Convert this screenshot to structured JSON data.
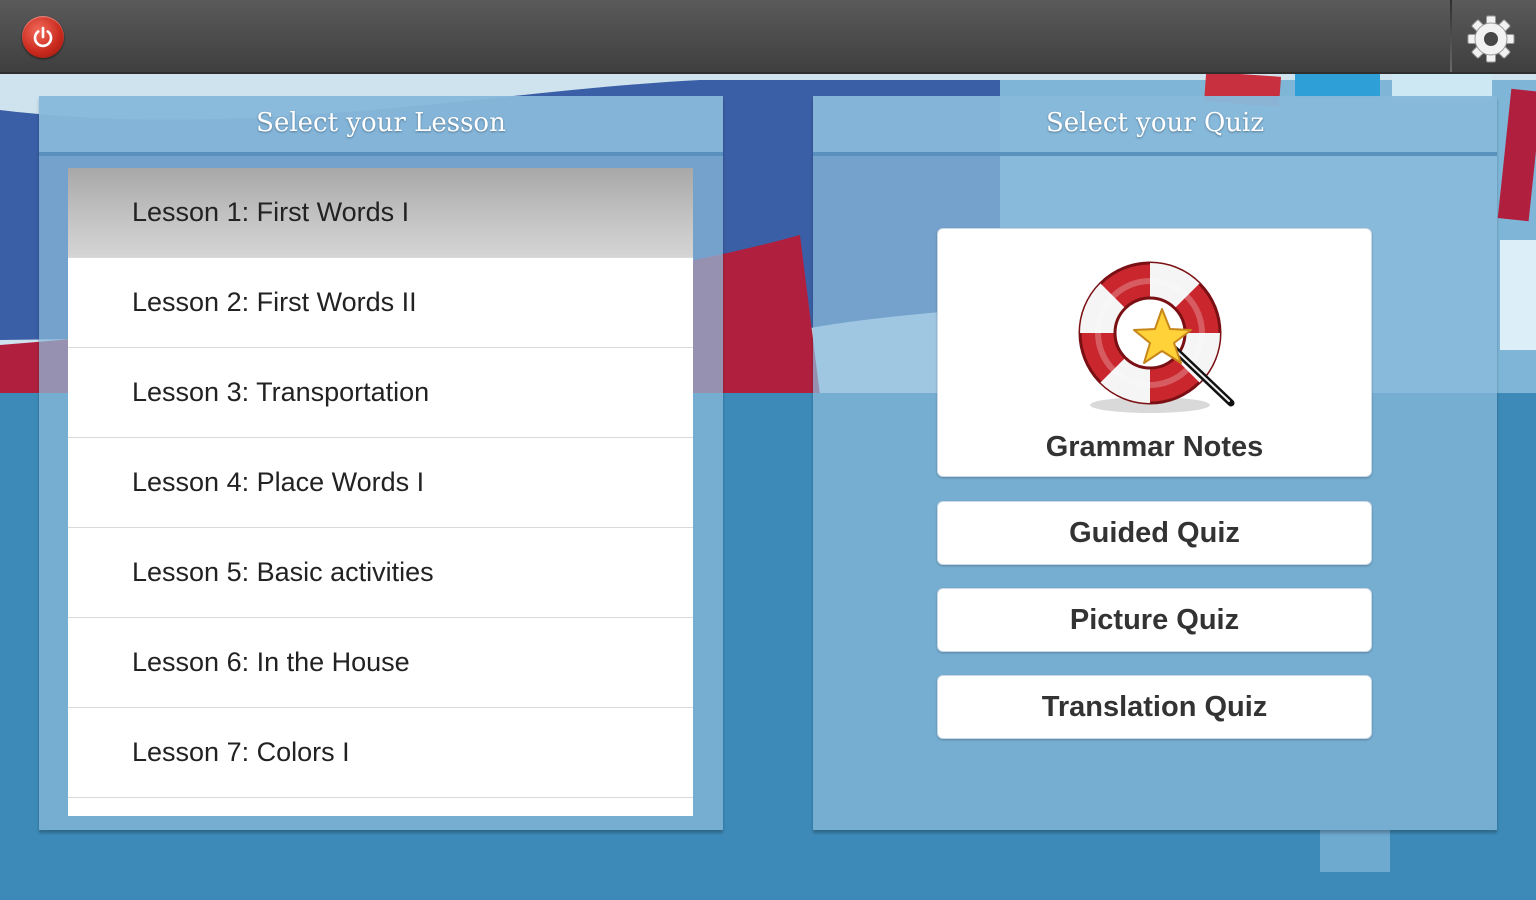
{
  "topbar": {
    "power_icon": "power-icon",
    "settings_icon": "gear-icon"
  },
  "lessons_panel": {
    "title": "Select your Lesson",
    "items": [
      {
        "label": "Lesson 1: First Words I",
        "selected": true
      },
      {
        "label": "Lesson 2: First Words II",
        "selected": false
      },
      {
        "label": "Lesson 3: Transportation",
        "selected": false
      },
      {
        "label": "Lesson 4: Place Words I",
        "selected": false
      },
      {
        "label": "Lesson 5: Basic activities",
        "selected": false
      },
      {
        "label": "Lesson 6: In the House",
        "selected": false
      },
      {
        "label": "Lesson 7: Colors I",
        "selected": false
      }
    ]
  },
  "quiz_panel": {
    "title": "Select your Quiz",
    "grammar_notes": {
      "label": "Grammar Notes",
      "icon": "lifebuoy-magic-wand-icon"
    },
    "guided_quiz": "Guided Quiz",
    "picture_quiz": "Picture Quiz",
    "translation_quiz": "Translation Quiz"
  },
  "colors": {
    "topbar": "#474747",
    "background_blue": "#3d8ab8",
    "accent_red": "#b0203e",
    "accent_navy": "#3b5fa6",
    "panel": "#8cbcdc",
    "selected_row": "#bdbdbd"
  }
}
